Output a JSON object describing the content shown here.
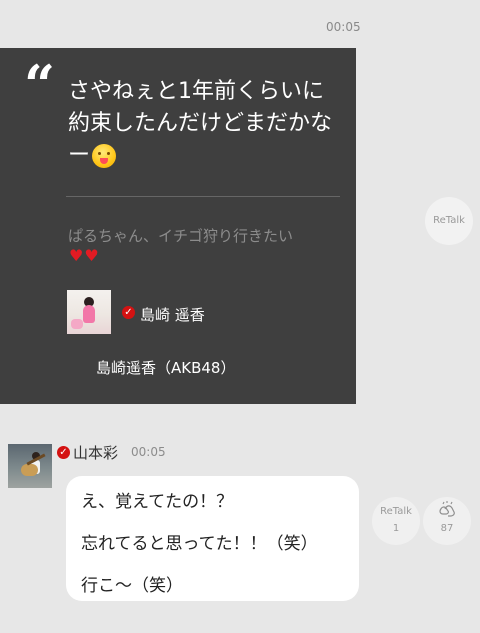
{
  "top_timestamp": "00:05",
  "quoted_post": {
    "quote_symbol": "“",
    "text": "さやねぇと1年前くらいに約束したんだけどまだかなー",
    "original_text": "ぱるちゃん、イチゴ狩り行きたい",
    "hearts": [
      "♥",
      "♥"
    ],
    "author_name": "島崎 遥香",
    "group_line": "島崎遥香（AKB48）"
  },
  "retalk_button": {
    "label": "ReTalk"
  },
  "comment": {
    "user_name": "山本彩",
    "timestamp": "00:05",
    "lines": [
      "え、覚えてたの！？",
      "忘れてると思ってた！！（笑）",
      "行こ～（笑）"
    ],
    "retalk_label": "ReTalk",
    "retalk_count": "1",
    "clap_count": "87"
  },
  "icons": {
    "verified": "verified-badge-icon",
    "clap": "clap-icon",
    "emoji": "smiling-emoji-icon"
  },
  "colors": {
    "background": "#e7e7e7",
    "card": "#3f3f3f",
    "verified": "#d41212",
    "heart": "#e31b23"
  }
}
